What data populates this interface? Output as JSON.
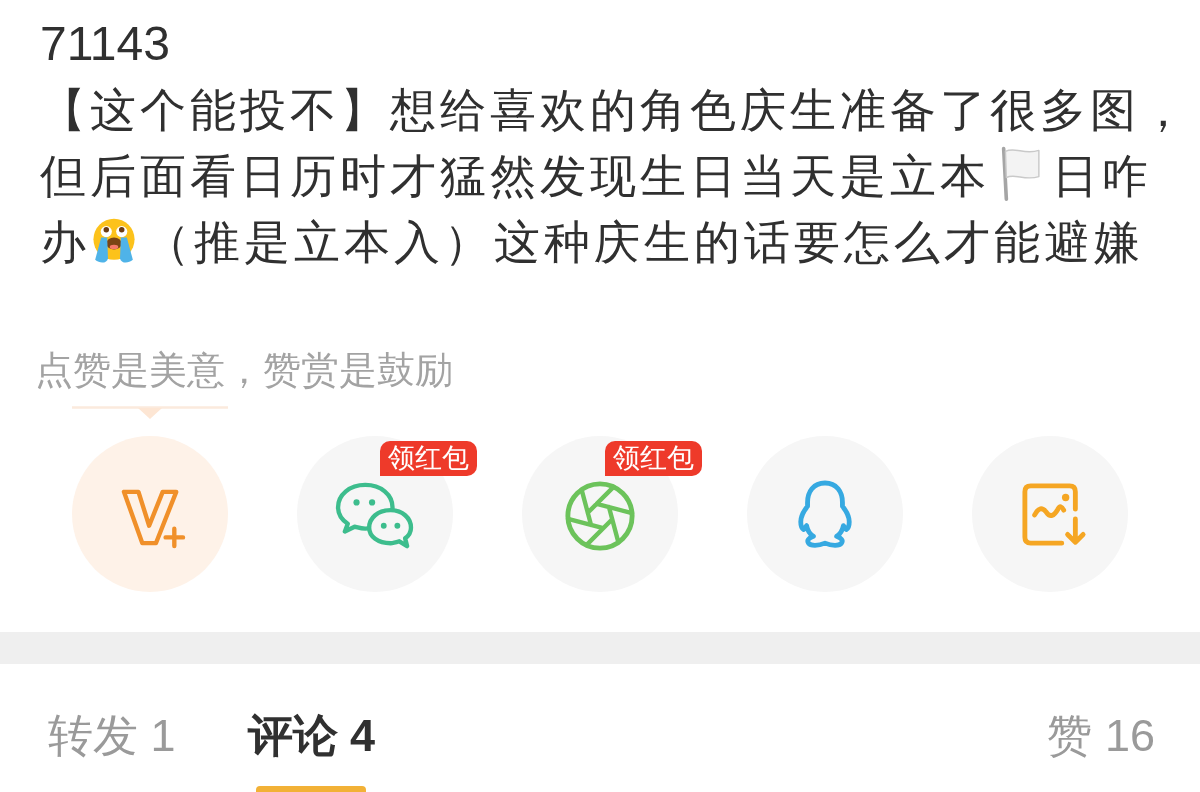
{
  "post": {
    "title": "71143",
    "body": [
      {
        "kind": "text",
        "text": "【这个能投不】想给喜欢的角色庆生准备了很多图，但后面看日历时才猛然发现生日当天是立本"
      },
      {
        "kind": "flag"
      },
      {
        "kind": "text",
        "text": "日咋办"
      },
      {
        "kind": "crying"
      },
      {
        "kind": "text",
        "text": "（推是立本入）这种庆生的话要怎么才能避嫌"
      }
    ]
  },
  "tip": {
    "text": "点赞是美意，赞赏是鼓励"
  },
  "share_buttons": [
    {
      "kind": "reward"
    },
    {
      "kind": "chat",
      "badge": "领红包"
    },
    {
      "kind": "aperture",
      "badge": "领红包"
    },
    {
      "kind": "penguin"
    },
    {
      "kind": "save"
    }
  ],
  "tabs": [
    {
      "label": "转发 1",
      "selected": false
    },
    {
      "label": "评论 4",
      "selected": true
    },
    {
      "label": "赞 16",
      "selected": false
    }
  ]
}
